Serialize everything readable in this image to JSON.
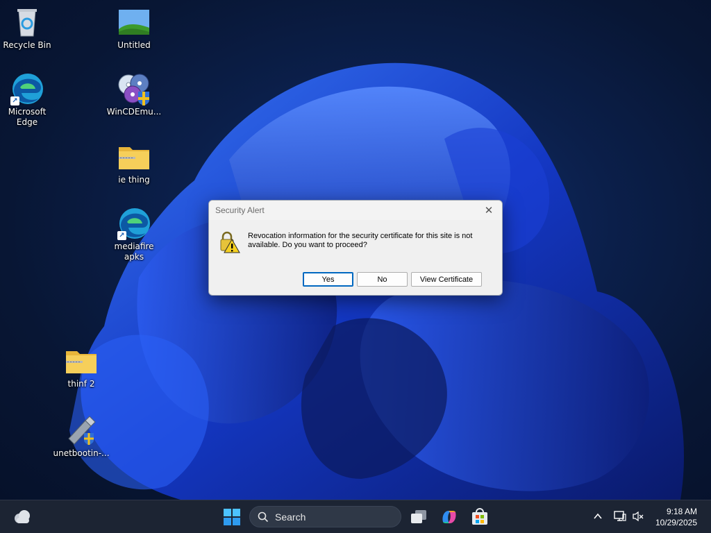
{
  "desktop": {
    "icons": [
      {
        "label": "Recycle Bin",
        "icon": "recycle-bin-icon"
      },
      {
        "label": "Untitled",
        "icon": "image-file-icon"
      },
      {
        "label": "Microsoft Edge",
        "icon": "edge-icon"
      },
      {
        "label": "WinCDEmu...",
        "icon": "disc-icon"
      },
      {
        "label": "ie thing",
        "icon": "zip-folder-icon"
      },
      {
        "label": "mediafire apks",
        "icon": "edge-icon"
      },
      {
        "label": "thinf 2",
        "icon": "zip-folder-icon"
      },
      {
        "label": "unetbootin-...",
        "icon": "usb-drive-icon"
      }
    ]
  },
  "dialog": {
    "title": "Security Alert",
    "message": "Revocation information for the security certificate for this site is not available. Do you want to proceed?",
    "buttons": {
      "yes": "Yes",
      "no": "No",
      "view": "View Certificate"
    },
    "close_glyph": "✕"
  },
  "taskbar": {
    "search_label": "Search",
    "time": "9:18 AM",
    "date": "10/29/2025",
    "accent": "#0078d4"
  }
}
